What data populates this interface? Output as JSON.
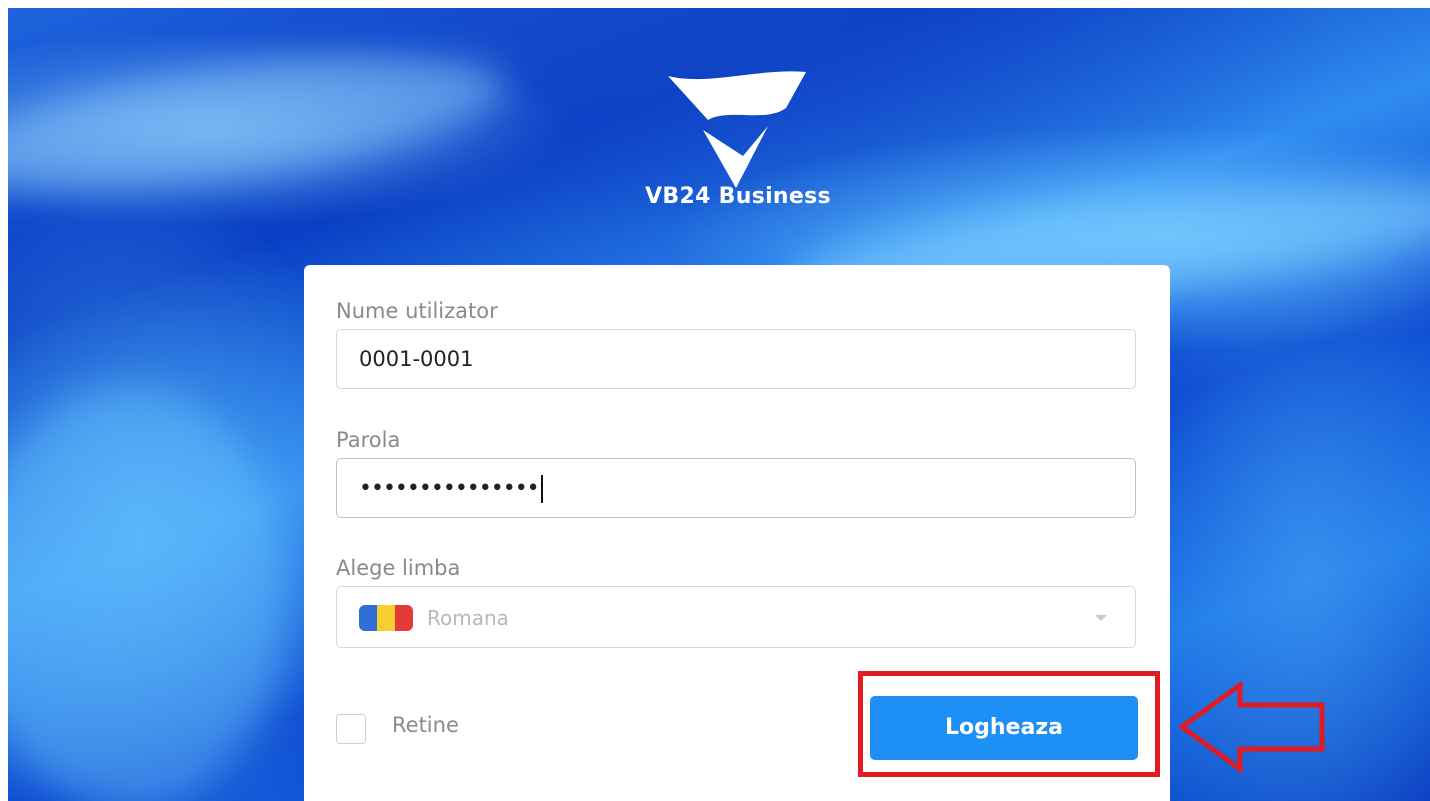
{
  "brand": {
    "name": "VB24 Business"
  },
  "login_form": {
    "username": {
      "label": "Nume utilizator",
      "value": "0001-0001"
    },
    "password": {
      "label": "Parola",
      "masked_value": "•••••••••••••••"
    },
    "language": {
      "label": "Alege limba",
      "selected": "Romana",
      "flag_colors": [
        "#2f6fd6",
        "#f6cf2e",
        "#e43a3a"
      ]
    },
    "remember": {
      "label": "Retine",
      "checked": false
    },
    "submit_label": "Logheaza"
  },
  "annotation": {
    "highlight_color": "#e11b22",
    "arrow_icon": "left-arrow-outline-icon"
  },
  "colors": {
    "button": "#1e8ff5",
    "background": "#0a3fc4"
  }
}
